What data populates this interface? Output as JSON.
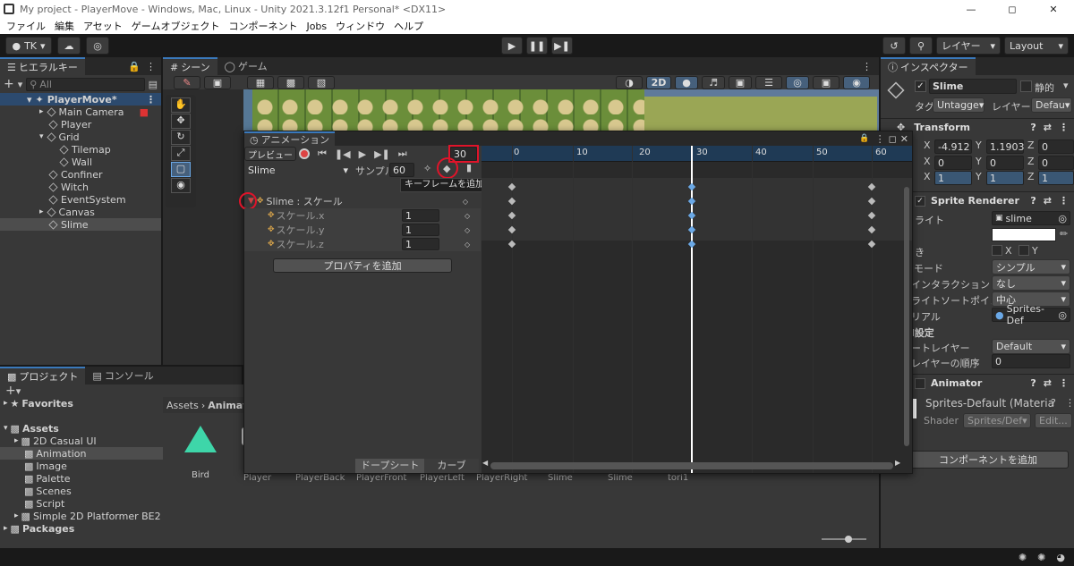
{
  "window": {
    "title": "My project - PlayerMove - Windows, Mac, Linux - Unity 2021.3.12f1 Personal* <DX11>"
  },
  "menu": [
    "ファイル",
    "編集",
    "アセット",
    "ゲームオブジェクト",
    "コンポーネント",
    "Jobs",
    "ウィンドウ",
    "ヘルプ"
  ],
  "toolbar": {
    "account": "TK",
    "layers": "レイヤー",
    "layout": "Layout"
  },
  "hierarchy": {
    "tab": "ヒエラルキー",
    "search_placeholder": "All",
    "items": [
      {
        "label": "PlayerMove*"
      },
      {
        "label": "Main Camera"
      },
      {
        "label": "Player"
      },
      {
        "label": "Grid"
      },
      {
        "label": "Tilemap"
      },
      {
        "label": "Wall"
      },
      {
        "label": "Confiner"
      },
      {
        "label": "Witch"
      },
      {
        "label": "EventSystem"
      },
      {
        "label": "Canvas"
      },
      {
        "label": "Slime"
      }
    ]
  },
  "scene_tabs": {
    "scene": "シーン",
    "game": "ゲーム",
    "mode_2d": "2D"
  },
  "project": {
    "tabs": {
      "project": "プロジェクト",
      "console": "コンソール"
    },
    "tree": [
      "Favorites",
      "Assets",
      "2D Casual UI",
      "Animation",
      "Image",
      "Palette",
      "Scenes",
      "Script",
      "Simple 2D Platformer BE2",
      "Packages"
    ],
    "breadcrumb": {
      "root": "Assets",
      "current": "Animat"
    },
    "files": [
      "Bird",
      "Player",
      "PlayerBack",
      "PlayerFront",
      "PlayerLeft",
      "PlayerRight",
      "Slime",
      "Slime",
      "tori1"
    ]
  },
  "animation": {
    "tab": "アニメーション",
    "preview": "プレビュー",
    "frame": "30",
    "clip": "Slime",
    "sample_label": "サンプル",
    "sample_value": "60",
    "tooltip": "キーフレームを追加",
    "property_group": "Slime : スケール",
    "properties": [
      {
        "name": "スケール.x",
        "value": "1"
      },
      {
        "name": "スケール.y",
        "value": "1"
      },
      {
        "name": "スケール.z",
        "value": "1"
      }
    ],
    "add_property": "プロパティを追加",
    "dopesheet": "ドープシート",
    "curves": "カーブ",
    "ruler": [
      "0",
      "10",
      "20",
      "30",
      "40",
      "50",
      "60"
    ]
  },
  "inspector": {
    "tab": "インスペクター",
    "name": "Slime",
    "static": "静的",
    "tag_label": "タグ",
    "tag": "Untagge",
    "layer_label": "レイヤー",
    "layer": "Defau",
    "transform": {
      "title": "Transform",
      "pos": {
        "x": "-4.912",
        "y": "1.1903",
        "z": "0"
      },
      "rot": {
        "x": "0",
        "y": "0",
        "z": "0"
      },
      "scale": {
        "x": "1",
        "y": "1",
        "z": "1"
      }
    },
    "sprite_renderer": {
      "title": "Sprite Renderer",
      "sprite_label": "ライト",
      "sprite": "slime",
      "flip_x": "X",
      "flip_y": "Y",
      "draw_mode_label": "iモード",
      "draw_mode": "シンプル",
      "interaction_label": "インタラクション",
      "interaction": "なし",
      "sort_point_label": "ライトソートポイント",
      "sort_point": "中心",
      "material_label": "リアル",
      "material": "Sprites-Def",
      "additional": "l設定",
      "sorting_layer_label": "ートレイヤー",
      "sorting_layer": "Default",
      "order_label": "レイヤーの順序",
      "order": "0"
    },
    "animator": {
      "title": "Animator"
    },
    "material": {
      "name": "Sprites-Default (Materia",
      "shader_label": "Shader",
      "shader": "Sprites/Def",
      "edit": "Edit..."
    },
    "add_component": "コンポーネントを追加"
  }
}
